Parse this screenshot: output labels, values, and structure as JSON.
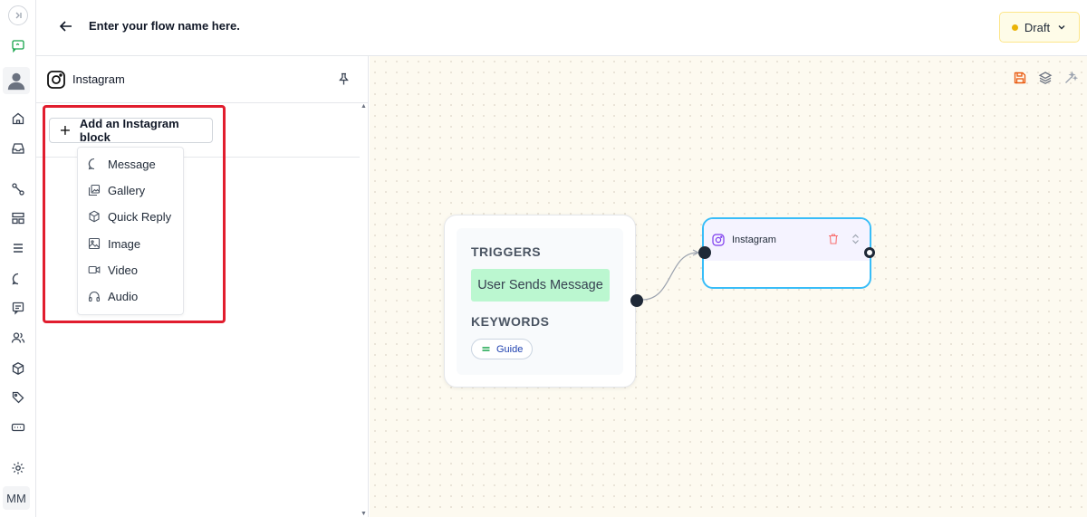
{
  "header": {
    "title": "Enter your flow name here.",
    "status_label": "Draft",
    "status_color": "#eab308"
  },
  "rail": {
    "items": [
      "collapse-icon",
      "chat-bot-icon",
      "avatar",
      "home-icon",
      "inbox-icon",
      "flows-icon",
      "templates-icon",
      "list-icon",
      "chat-icon",
      "message-square-icon",
      "contacts-icon",
      "box-icon",
      "tag-icon",
      "keyboard-icon",
      "settings-icon"
    ],
    "user_initials": "MM"
  },
  "panel": {
    "title": "Instagram",
    "add_button_label": "Add an Instagram block",
    "menu": [
      {
        "label": "Message",
        "icon": "message-circle-icon"
      },
      {
        "label": "Gallery",
        "icon": "gallery-icon"
      },
      {
        "label": "Quick Reply",
        "icon": "cube-icon"
      },
      {
        "label": "Image",
        "icon": "image-icon"
      },
      {
        "label": "Video",
        "icon": "video-icon"
      },
      {
        "label": "Audio",
        "icon": "headphones-icon"
      }
    ],
    "highlight_color": "#e11d2e"
  },
  "canvas": {
    "tools": [
      "save-icon",
      "layers-icon",
      "magic-wand-icon"
    ],
    "trigger_card": {
      "triggers_label": "TRIGGERS",
      "trigger_value": "User Sends Message",
      "keywords_label": "KEYWORDS",
      "keyword": "Guide"
    },
    "instagram_node": {
      "title": "Instagram",
      "border_color": "#38bdf8"
    }
  }
}
